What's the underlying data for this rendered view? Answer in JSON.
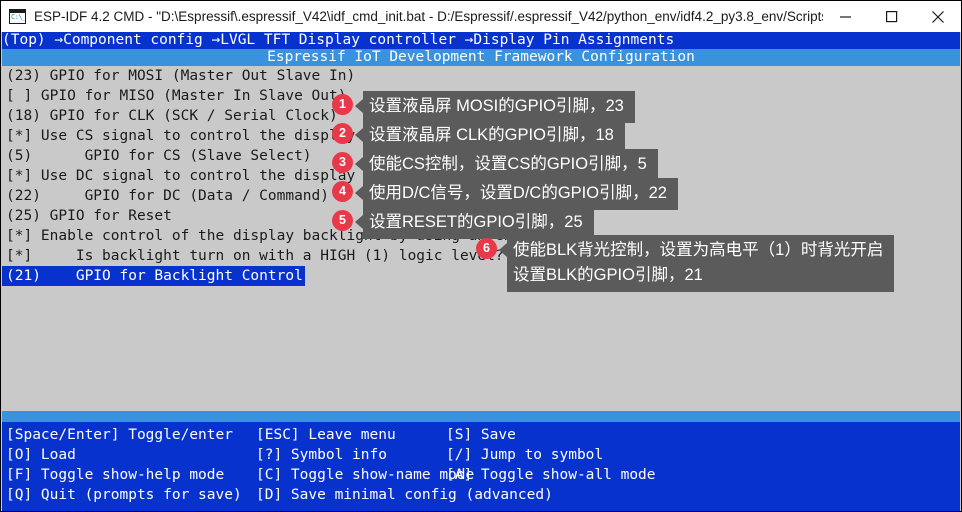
{
  "window": {
    "title": "ESP-IDF 4.2 CMD - \"D:\\Espressif\\.espressif_V42\\idf_cmd_init.bat - D:/Espressif/.espressif_V42/python_env/idf4.2_py3.8_env/Scripts\\pyth...",
    "icon": "cmd-prompt-icon",
    "icon_glyph": "C:\\_",
    "controls": {
      "minimize": "minimize-icon",
      "maximize": "maximize-icon",
      "close": "close-icon"
    }
  },
  "console": {
    "breadcrumb": "(Top) →Component config →LVGL TFT Display controller →Display Pin Assignments",
    "config_title": "Espressif IoT Development Framework Configuration",
    "menu_items": [
      {
        "text": "(23) GPIO for MOSI (Master Out Slave In)",
        "selected": false
      },
      {
        "text": "[ ] GPIO for MISO (Master In Slave Out)",
        "selected": false
      },
      {
        "text": "(18) GPIO for CLK (SCK / Serial Clock)",
        "selected": false
      },
      {
        "text": "[*] Use CS signal to control the display",
        "selected": false
      },
      {
        "text": "(5)      GPIO for CS (Slave Select)",
        "selected": false
      },
      {
        "text": "[*] Use DC signal to control the display",
        "selected": false
      },
      {
        "text": "(22)     GPIO for DC (Data / Command)",
        "selected": false
      },
      {
        "text": "(25) GPIO for Reset",
        "selected": false
      },
      {
        "text": "[*] Enable control of the display backlight by using an GPIO.",
        "selected": false
      },
      {
        "text": "[*]     Is backlight turn on with a HIGH (1) logic level?",
        "selected": false
      },
      {
        "text": "(21)    GPIO for Backlight Control",
        "selected": true
      }
    ]
  },
  "help": {
    "rows": [
      {
        "c1": "[Space/Enter] Toggle/enter",
        "c2": "[ESC] Leave menu",
        "c3": "[S] Save"
      },
      {
        "c1": "[O] Load",
        "c2": "[?] Symbol info",
        "c3": "[/] Jump to symbol"
      },
      {
        "c1": "[F] Toggle show-help mode",
        "c2": "[C] Toggle show-name mode",
        "c3": "[A] Toggle show-all mode"
      },
      {
        "c1": "[Q] Quit (prompts for save)",
        "c2": "[D] Save minimal config (advanced)",
        "c3": ""
      }
    ]
  },
  "annotations": [
    {
      "number": "1",
      "text": "设置液晶屏 MOSI的GPIO引脚，23"
    },
    {
      "number": "2",
      "text": "设置液晶屏 CLK的GPIO引脚，18"
    },
    {
      "number": "3",
      "text": "使能CS控制，设置CS的GPIO引脚，5"
    },
    {
      "number": "4",
      "text": "使用D/C信号，设置D/C的GPIO引脚，22"
    },
    {
      "number": "5",
      "text": "设置RESET的GPIO引脚，25"
    },
    {
      "number": "6",
      "text": "使能BLK背光控制，设置为高电平（1）时背光开启\n设置BLK的GPIO引脚，21"
    }
  ],
  "colors": {
    "console_blue": "#0732ce",
    "title_blue": "#3a92dd",
    "console_bg": "#c9c9c9",
    "badge_red": "#e8394a",
    "tooltip_grey": "#5b5b5b"
  }
}
